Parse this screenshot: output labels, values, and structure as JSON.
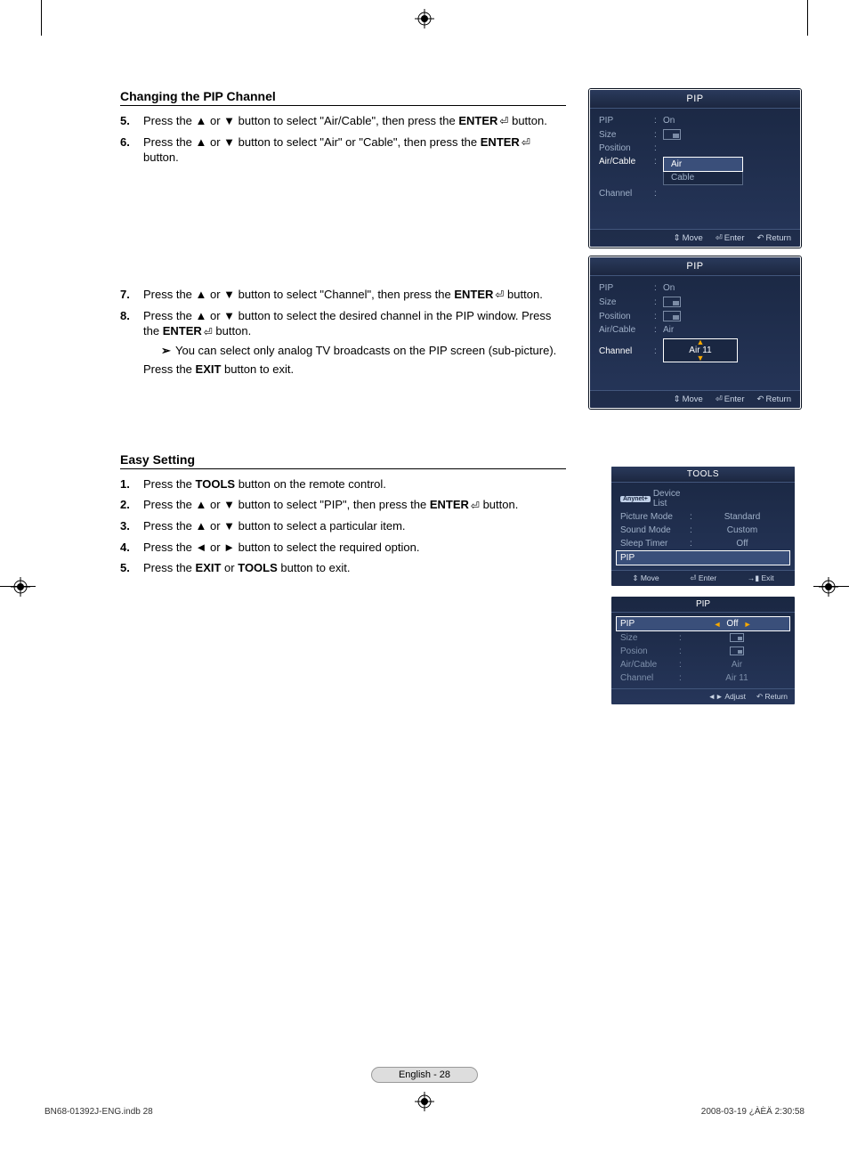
{
  "section1_heading": "Changing the PIP Channel",
  "steps_a": [
    {
      "num": "5.",
      "text_pre": "Press the ▲ or ▼ button to select \"Air/Cable\", then press the ",
      "bold": "ENTER",
      "text_post": " button."
    },
    {
      "num": "6.",
      "text_pre": "Press the ▲ or ▼ button to select \"Air\" or \"Cable\", then press the ",
      "bold": "ENTER",
      "text_post": " button."
    }
  ],
  "steps_b": [
    {
      "num": "7.",
      "text_pre": "Press the ▲ or ▼ button to select \"Channel\", then press the ",
      "bold": "ENTER",
      "text_post": " button."
    },
    {
      "num": "8.",
      "text_pre": "Press the ▲ or ▼ button to select the desired channel in the PIP window. Press the ",
      "bold": "ENTER",
      "text_post": " button."
    }
  ],
  "note_line": "You can select only analog TV broadcasts on the PIP screen (sub-picture).",
  "exit_line_pre": "Press the ",
  "exit_bold": "EXIT",
  "exit_line_post": " button to exit.",
  "section2_heading": "Easy Setting",
  "easy_steps": [
    {
      "num": "1.",
      "parts": "Press the |TOOLS| button on the remote control."
    },
    {
      "num": "2.",
      "parts": "Press the ▲ or ▼ button to select \"PIP\", then press the |ENTER| button."
    },
    {
      "num": "3.",
      "parts": "Press the ▲ or ▼ button to select a particular item."
    },
    {
      "num": "4.",
      "parts": "Press the ◄ or ► button to select the required option."
    },
    {
      "num": "5.",
      "parts": "Press the |EXIT| or |TOOLS| button to exit."
    }
  ],
  "enter_icon": "⏎",
  "osd_pip_title": "PIP",
  "osd1": {
    "rows": {
      "pip": {
        "label": "PIP",
        "val": "On"
      },
      "size": {
        "label": "Size"
      },
      "position": {
        "label": "Position"
      },
      "aircable": {
        "label": "Air/Cable"
      },
      "channel": {
        "label": "Channel"
      }
    },
    "dropdown": {
      "opt1": "Air",
      "opt2": "Cable"
    },
    "hints": {
      "move": "Move",
      "enter": "Enter",
      "return": "Return"
    }
  },
  "osd2": {
    "rows": {
      "pip": {
        "label": "PIP",
        "val": "On"
      },
      "size": {
        "label": "Size"
      },
      "position": {
        "label": "Position"
      },
      "aircable": {
        "label": "Air/Cable",
        "val": "Air"
      },
      "channel": {
        "label": "Channel",
        "val": "Air 11"
      }
    },
    "hints": {
      "move": "Move",
      "enter": "Enter",
      "return": "Return"
    }
  },
  "tools": {
    "title": "TOOLS",
    "device_badge": "Anynet+",
    "device": "Device List",
    "rows": [
      {
        "label": "Picture Mode",
        "val": "Standard"
      },
      {
        "label": "Sound Mode",
        "val": "Custom"
      },
      {
        "label": "Sleep Timer",
        "val": "Off"
      }
    ],
    "selected": "PIP",
    "hints": {
      "move": "Move",
      "enter": "Enter",
      "exit": "Exit"
    }
  },
  "pipsub": {
    "title": "PIP",
    "rows": {
      "pip": {
        "label": "PIP",
        "val": "Off"
      },
      "size": {
        "label": "Size"
      },
      "posion": {
        "label": "Posion"
      },
      "aircable": {
        "label": "Air/Cable",
        "val": "Air"
      },
      "channel": {
        "label": "Channel",
        "val": "Air 11"
      }
    },
    "hints": {
      "adjust": "Adjust",
      "return": "Return"
    }
  },
  "page_pill": "English - 28",
  "footer_left": "BN68-01392J-ENG.indb   28",
  "footer_right": "2008-03-19   ¿ÀÈÄ 2:30:58"
}
